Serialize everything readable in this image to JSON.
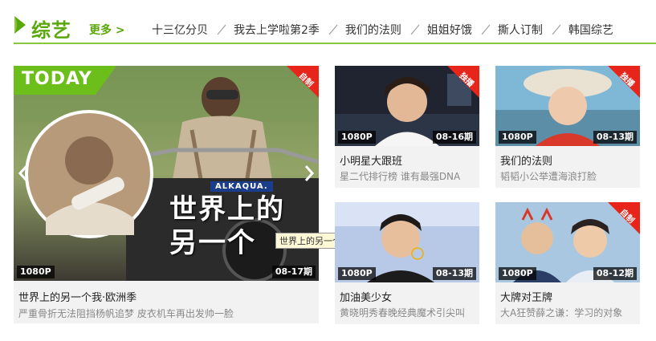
{
  "header": {
    "title": "综艺",
    "more_label": "更多 >",
    "nav": [
      "十三亿分贝",
      "我去上学啦第2季",
      "我们的法则",
      "姐姐好饿",
      "撕人订制",
      "韩国综艺"
    ]
  },
  "featured": {
    "badge": "TODAY",
    "corner_label": "自制",
    "caption_line1": "世界上的",
    "caption_line2": "另一个",
    "brand": "ALKAQUA.",
    "tooltip": "世界上的另一个我·欧洲季",
    "resolution": "1080P",
    "episode": "08-17期",
    "title": "世界上的另一个我·欧洲季",
    "description": "严重骨折无法阻挡杨帆追梦 皮衣机车再出发帅一脸"
  },
  "cards": [
    {
      "corner_label": "独播",
      "resolution": "1080P",
      "episode": "08-16期",
      "title": "小明星大跟班",
      "description": "星二代排行榜 谁有最强DNA"
    },
    {
      "corner_label": "独播",
      "resolution": "1080P",
      "episode": "08-13期",
      "title": "我们的法则",
      "description": "韬韬小公举遭海浪打脸"
    },
    {
      "corner_label": "",
      "resolution": "1080P",
      "episode": "08-13期",
      "title": "加油美少女",
      "description": "黄晓明秀春晚经典魔术引尖叫"
    },
    {
      "corner_label": "自制",
      "resolution": "1080P",
      "episode": "08-12期",
      "title": "大牌对王牌",
      "description": "大A狂赞薛之谦：学习的对象"
    }
  ],
  "colors": {
    "accent": "#5aa70b",
    "rule": "#8cc63f",
    "corner": "#e8251b"
  },
  "icons": {
    "header": "leaf-icon",
    "prev": "chevron-left-icon",
    "next": "chevron-right-icon",
    "nav_separator": "slash-icon"
  }
}
